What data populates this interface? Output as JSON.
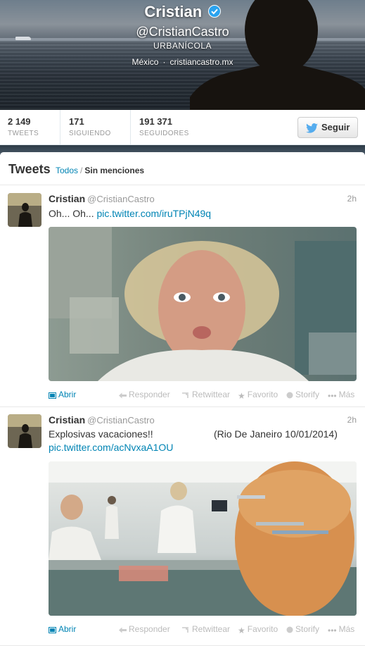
{
  "profile": {
    "name": "Cristian",
    "handle": "@CristianCastro",
    "bio": "URBANÍCOLA",
    "location": "México",
    "location_sep": "·",
    "website": "cristiancastro.mx"
  },
  "stats": {
    "tweets": {
      "value": "2 149",
      "label": "TWEETS"
    },
    "following": {
      "value": "171",
      "label": "SIGUIENDO"
    },
    "followers": {
      "value": "191 371",
      "label": "SEGUIDORES"
    }
  },
  "follow_label": "Seguir",
  "timeline": {
    "title": "Tweets",
    "filter_all": "Todos",
    "filter_sep": "/",
    "filter_no_mentions": "Sin menciones"
  },
  "tweets": [
    {
      "name": "Cristian",
      "user": "@CristianCastro",
      "time": "2h",
      "text": "Oh... Oh...",
      "text_extra": "",
      "link": "pic.twitter.com/iruTPjN49q"
    },
    {
      "name": "Cristian",
      "user": "@CristianCastro",
      "time": "2h",
      "text": "Explosivas vacaciones!!",
      "text_extra": "(Rio De Janeiro 10/01/2014)",
      "link": "pic.twitter.com/acNvxaA1OU"
    }
  ],
  "actions": {
    "open": "Abrir",
    "reply": "Responder",
    "retweet": "Retwittear",
    "favorite": "Favorito",
    "storify": "Storify",
    "more": "Más"
  },
  "colors": {
    "link": "#0084b4",
    "verified": "#2aa3ef",
    "twitter_bird": "#55acee"
  }
}
